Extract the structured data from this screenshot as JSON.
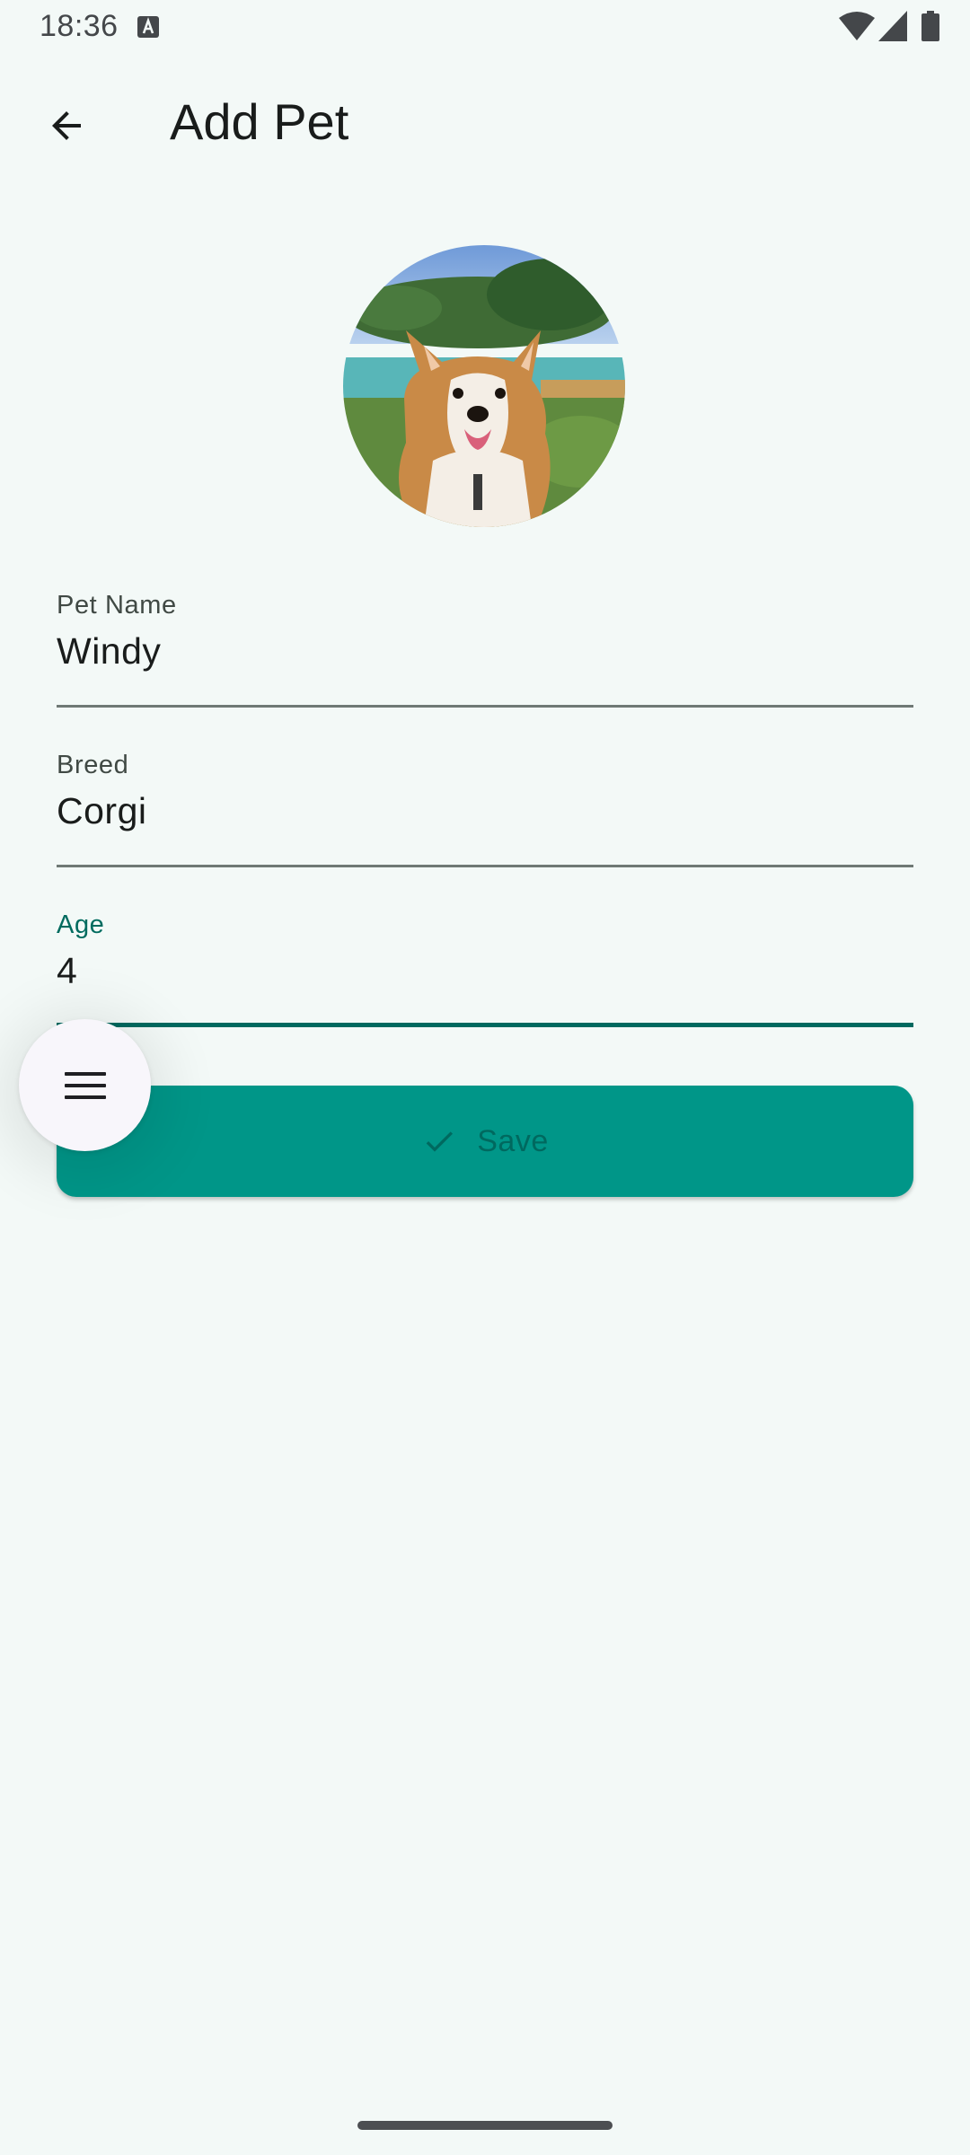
{
  "status_bar": {
    "time": "18:36",
    "icons": [
      "notification-a-icon",
      "wifi-icon",
      "signal-icon",
      "battery-icon"
    ]
  },
  "app_bar": {
    "title": "Add Pet",
    "back_icon": "arrow-back-icon"
  },
  "avatar": {
    "description": "corgi-photo"
  },
  "form": {
    "pet_name": {
      "label": "Pet Name",
      "value": "Windy"
    },
    "breed": {
      "label": "Breed",
      "value": "Corgi"
    },
    "age": {
      "label": "Age",
      "value": "4",
      "focused": true
    }
  },
  "save_button": {
    "label": "Save",
    "icon": "check-icon"
  },
  "fab": {
    "icon": "menu-icon"
  },
  "colors": {
    "background": "#f3f9f7",
    "primary": "#009688",
    "primary_dark": "#00695f",
    "fab_background": "#f8f6fb"
  }
}
